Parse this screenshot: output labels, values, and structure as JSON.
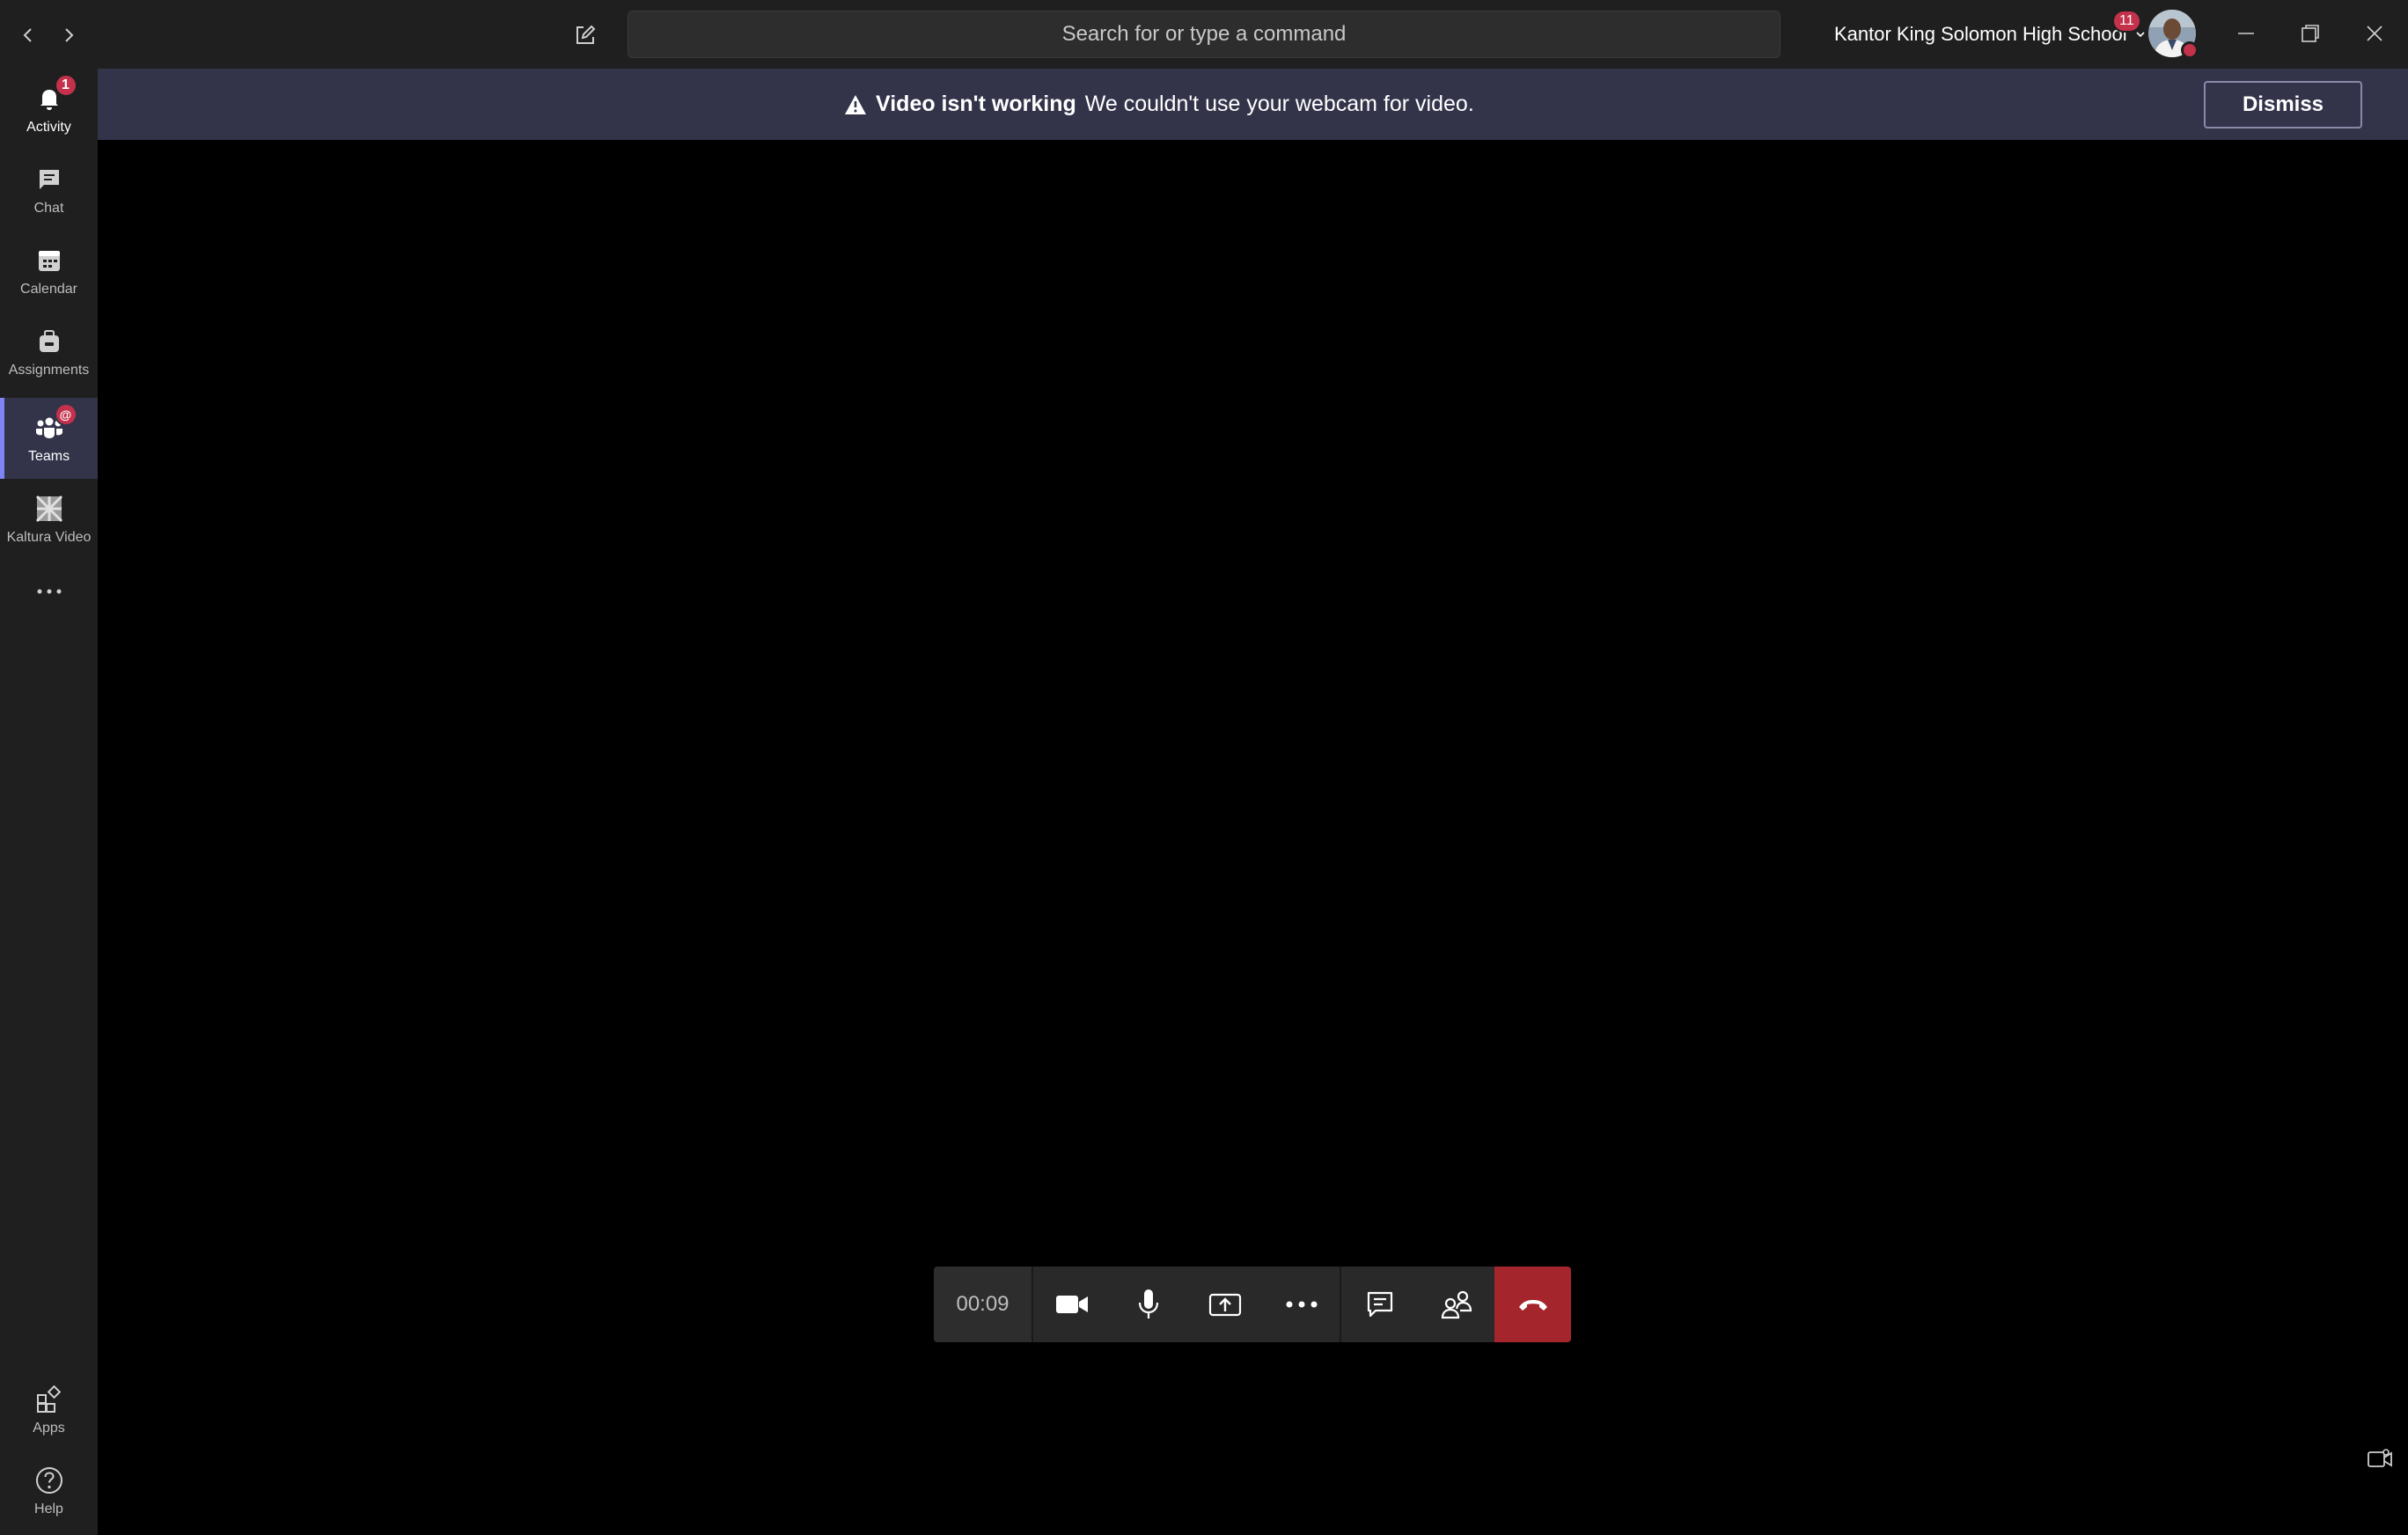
{
  "titlebar": {
    "search_placeholder": "Search for or type a command",
    "org_name": "Kantor King Solomon High School",
    "org_badge": "11",
    "icons": {
      "back": "chevron-left-icon",
      "forward": "chevron-right-icon",
      "compose": "compose-icon",
      "org_dropdown": "chevron-down-icon",
      "minimize": "minimize-icon",
      "restore": "restore-icon",
      "close": "close-icon"
    }
  },
  "rail": {
    "items": [
      {
        "label": "Activity",
        "icon": "bell-icon",
        "badge": "1"
      },
      {
        "label": "Chat",
        "icon": "chat-icon"
      },
      {
        "label": "Calendar",
        "icon": "calendar-icon"
      },
      {
        "label": "Assignments",
        "icon": "assignments-icon"
      },
      {
        "label": "Teams",
        "icon": "teams-icon",
        "badge": "@",
        "active": true
      },
      {
        "label": "Kaltura Video",
        "icon": "kaltura-icon"
      },
      {
        "label": "",
        "icon": "more-icon"
      }
    ],
    "bottom": [
      {
        "label": "Apps",
        "icon": "apps-icon"
      },
      {
        "label": "Help",
        "icon": "help-icon"
      }
    ]
  },
  "banner": {
    "title": "Video isn't working",
    "message": "We couldn't use your webcam for video.",
    "dismiss_label": "Dismiss",
    "icon": "warning-icon"
  },
  "call_controls": {
    "timer": "00:09",
    "buttons": [
      "camera-icon",
      "microphone-icon",
      "share-screen-icon",
      "more-actions-icon",
      "chat-icon",
      "participants-icon",
      "hang-up-icon"
    ]
  },
  "colors": {
    "chrome": "#1f1f1f",
    "banner": "#33344a",
    "accent": "#7f85f5",
    "badge": "#c4314b",
    "hangup": "#a4262c"
  }
}
